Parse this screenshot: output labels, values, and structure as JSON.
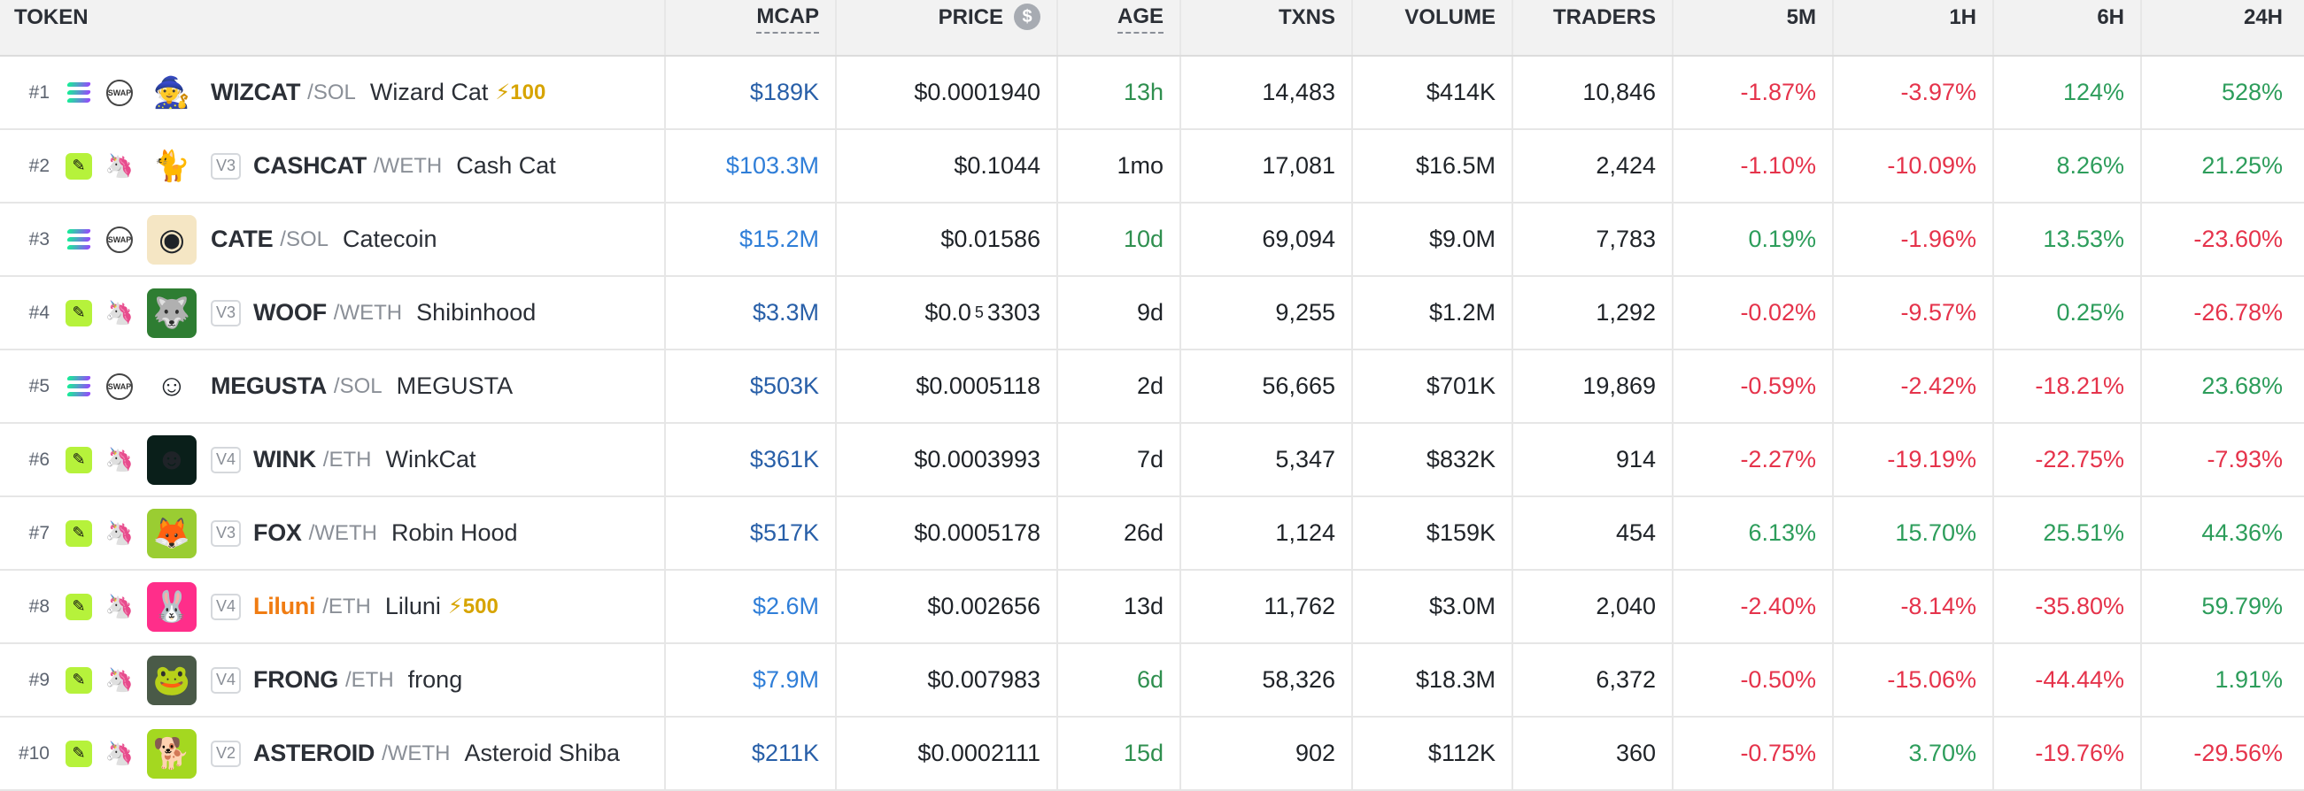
{
  "headers": {
    "token": "TOKEN",
    "mcap": "MCAP",
    "price": "PRICE",
    "age": "AGE",
    "txns": "TXNS",
    "volume": "VOLUME",
    "traders": "TRADERS",
    "m5": "5M",
    "h1": "1H",
    "h6": "6H",
    "h24": "24H",
    "price_currency_icon": "$"
  },
  "colors": {
    "positive": "#2d9d5b",
    "negative": "#e5334b",
    "mcap_blue": "#2f7ed8",
    "boost": "#d7a400"
  },
  "rows": [
    {
      "rank": "#1",
      "chain": "sol-icon",
      "dex": "swap-icon",
      "avatar": "🧙",
      "avatar_bg": "#ffffff",
      "version": "",
      "symbol": "WIZCAT",
      "quote": "/SOL",
      "name": "Wizard Cat",
      "boost": "⚡100",
      "mcap": "$189K",
      "price": "$0.0001940",
      "age": "13h",
      "txns": "14,483",
      "volume": "$414K",
      "traders": "10,846",
      "m5": "-1.87%",
      "h1": "-3.97%",
      "h6": "124%",
      "h24": "528%"
    },
    {
      "rank": "#2",
      "chain": "eth-icon",
      "dex": "uniswap-icon",
      "avatar": "🐈",
      "avatar_bg": "#ffffff",
      "version": "V3",
      "symbol": "CASHCAT",
      "quote": "/WETH",
      "name": "Cash Cat",
      "boost": "",
      "mcap": "$103.3M",
      "price": "$0.1044",
      "age": "1mo",
      "txns": "17,081",
      "volume": "$16.5M",
      "traders": "2,424",
      "m5": "-1.10%",
      "h1": "-10.09%",
      "h6": "8.26%",
      "h24": "21.25%"
    },
    {
      "rank": "#3",
      "chain": "sol-icon",
      "dex": "swap-icon",
      "avatar": "◉",
      "avatar_bg": "#f5e6c4",
      "version": "",
      "symbol": "CATE",
      "quote": "/SOL",
      "name": "Catecoin",
      "boost": "",
      "mcap": "$15.2M",
      "price": "$0.01586",
      "age": "10d",
      "txns": "69,094",
      "volume": "$9.0M",
      "traders": "7,783",
      "m5": "0.19%",
      "h1": "-1.96%",
      "h6": "13.53%",
      "h24": "-23.60%"
    },
    {
      "rank": "#4",
      "chain": "eth-icon",
      "dex": "uniswap-icon",
      "avatar": "🐺",
      "avatar_bg": "#2e7d32",
      "version": "V3",
      "symbol": "WOOF",
      "quote": "/WETH",
      "name": "Shibinhood",
      "boost": "",
      "mcap": "$3.3M",
      "price_prefix": "$0.0",
      "price_sub": "5",
      "price_tail": "3303",
      "price": "",
      "age": "9d",
      "txns": "9,255",
      "volume": "$1.2M",
      "traders": "1,292",
      "m5": "-0.02%",
      "h1": "-9.57%",
      "h6": "0.25%",
      "h24": "-26.78%"
    },
    {
      "rank": "#5",
      "chain": "sol-icon",
      "dex": "swap-icon",
      "avatar": "☺",
      "avatar_bg": "#ffffff",
      "version": "",
      "symbol": "MEGUSTA",
      "quote": "/SOL",
      "name": "MEGUSTA",
      "boost": "",
      "mcap": "$503K",
      "price": "$0.0005118",
      "age": "2d",
      "txns": "56,665",
      "volume": "$701K",
      "traders": "19,869",
      "m5": "-0.59%",
      "h1": "-2.42%",
      "h6": "-18.21%",
      "h24": "23.68%"
    },
    {
      "rank": "#6",
      "chain": "eth-icon",
      "dex": "uniswap-icon",
      "avatar": "☻",
      "avatar_bg": "#0a1f1a",
      "version": "V4",
      "symbol": "WINK",
      "quote": "/ETH",
      "name": "WinkCat",
      "boost": "",
      "mcap": "$361K",
      "price": "$0.0003993",
      "age": "7d",
      "txns": "5,347",
      "volume": "$832K",
      "traders": "914",
      "m5": "-2.27%",
      "h1": "-19.19%",
      "h6": "-22.75%",
      "h24": "-7.93%"
    },
    {
      "rank": "#7",
      "chain": "eth-icon",
      "dex": "uniswap-icon",
      "avatar": "🦊",
      "avatar_bg": "#9acd32",
      "version": "V3",
      "symbol": "FOX",
      "quote": "/WETH",
      "name": "Robin Hood",
      "boost": "",
      "mcap": "$517K",
      "price": "$0.0005178",
      "age": "26d",
      "txns": "1,124",
      "volume": "$159K",
      "traders": "454",
      "m5": "6.13%",
      "h1": "15.70%",
      "h6": "25.51%",
      "h24": "44.36%"
    },
    {
      "rank": "#8",
      "chain": "eth-icon",
      "dex": "uniswap-icon",
      "avatar": "🐰",
      "avatar_bg": "#ff2e8a",
      "version": "V4",
      "symbol": "Liluni",
      "quote": "/ETH",
      "name": "Liluni",
      "boost": "⚡500",
      "mcap": "$2.6M",
      "price": "$0.002656",
      "age": "13d",
      "txns": "11,762",
      "volume": "$3.0M",
      "traders": "2,040",
      "m5": "-2.40%",
      "h1": "-8.14%",
      "h6": "-35.80%",
      "h24": "59.79%"
    },
    {
      "rank": "#9",
      "chain": "eth-icon",
      "dex": "uniswap-icon",
      "avatar": "🐸",
      "avatar_bg": "#4a5a48",
      "version": "V4",
      "symbol": "FRONG",
      "quote": "/ETH",
      "name": "frong",
      "boost": "",
      "mcap": "$7.9M",
      "price": "$0.007983",
      "age": "6d",
      "txns": "58,326",
      "volume": "$18.3M",
      "traders": "6,372",
      "m5": "-0.50%",
      "h1": "-15.06%",
      "h6": "-44.44%",
      "h24": "1.91%"
    },
    {
      "rank": "#10",
      "chain": "eth-icon",
      "dex": "uniswap-icon",
      "avatar": "🐕",
      "avatar_bg": "#a4d820",
      "version": "V2",
      "symbol": "ASTEROID",
      "quote": "/WETH",
      "name": "Asteroid Shiba",
      "boost": "",
      "mcap": "$211K",
      "price": "$0.0002111",
      "age": "15d",
      "txns": "902",
      "volume": "$112K",
      "traders": "360",
      "m5": "-0.75%",
      "h1": "3.70%",
      "h6": "-19.76%",
      "h24": "-29.56%"
    }
  ]
}
